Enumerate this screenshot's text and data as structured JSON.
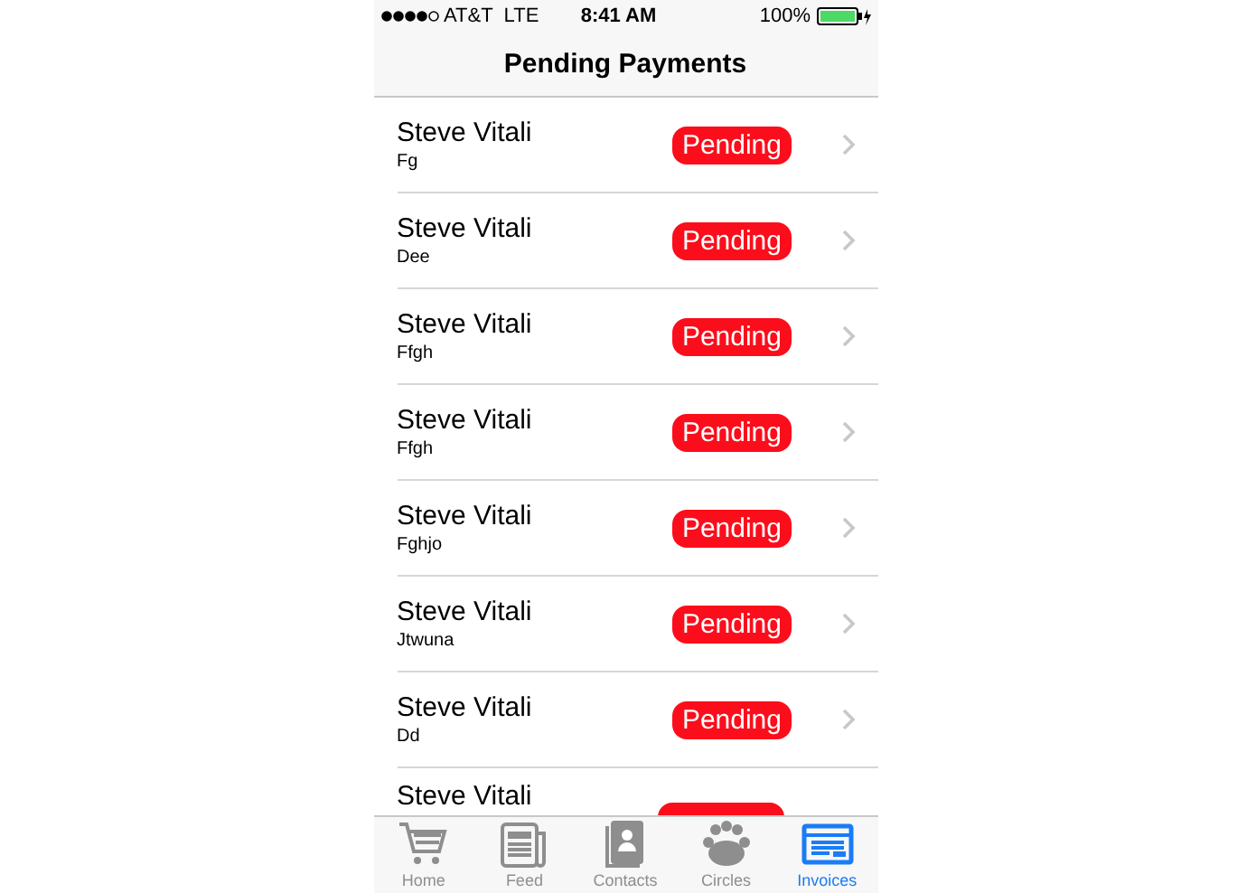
{
  "status_bar": {
    "carrier": "AT&T",
    "network": "LTE",
    "time": "8:41 AM",
    "battery": "100%"
  },
  "title": "Pending Payments",
  "rows": [
    {
      "name": "Steve Vitali",
      "note": "Fg",
      "status": "Pending"
    },
    {
      "name": "Steve Vitali",
      "note": "Dee",
      "status": "Pending"
    },
    {
      "name": "Steve Vitali",
      "note": "Ffgh",
      "status": "Pending"
    },
    {
      "name": "Steve Vitali",
      "note": "Ffgh",
      "status": "Pending"
    },
    {
      "name": "Steve Vitali",
      "note": "Fghjo",
      "status": "Pending"
    },
    {
      "name": "Steve Vitali",
      "note": "Jtwuna",
      "status": "Pending"
    },
    {
      "name": "Steve Vitali",
      "note": "Dd",
      "status": "Pending"
    },
    {
      "name": "Steve Vitali",
      "kind": "partial"
    }
  ],
  "tabs": [
    {
      "label": "Home",
      "kind": "cart",
      "selected": false
    },
    {
      "label": "Feed",
      "kind": "news",
      "selected": false
    },
    {
      "label": "Contacts",
      "kind": "contacts",
      "selected": false
    },
    {
      "label": "Circles",
      "kind": "people",
      "selected": false
    },
    {
      "label": "Invoices",
      "kind": "invoice",
      "selected": true
    }
  ]
}
